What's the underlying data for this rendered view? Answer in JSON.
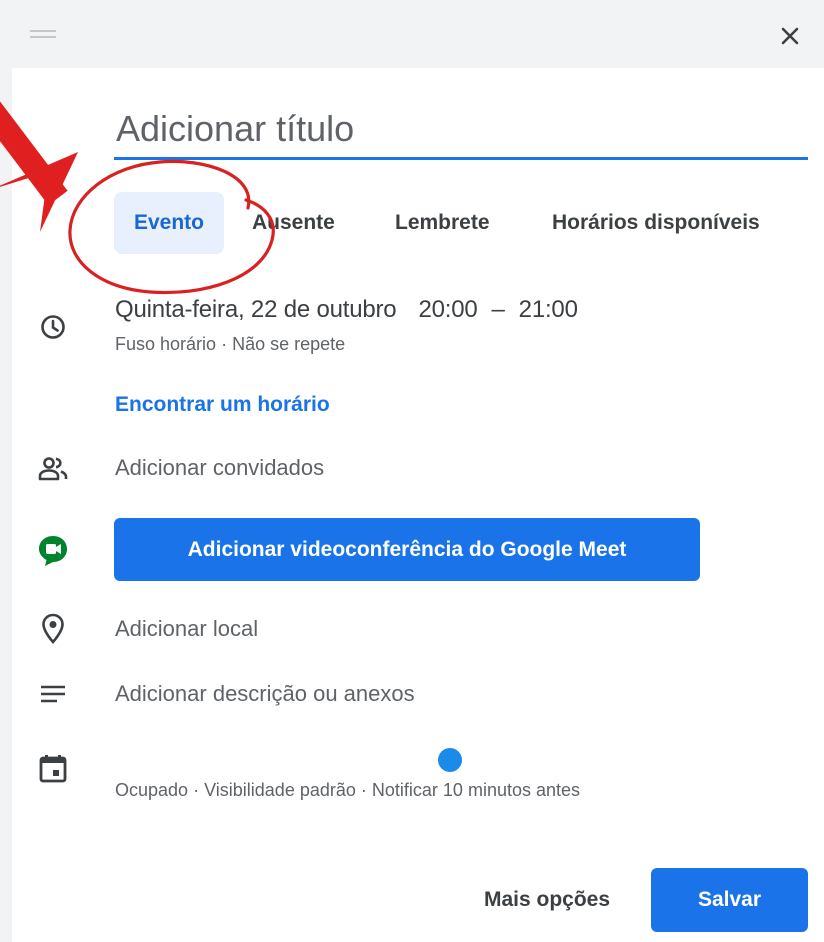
{
  "dialog": {
    "close_icon": "close-icon",
    "drag_icon": "drag-handle-icon"
  },
  "title": {
    "placeholder": "Adicionar título"
  },
  "tabs": [
    {
      "label": "Evento",
      "selected": true
    },
    {
      "label": "Ausente",
      "selected": false
    },
    {
      "label": "Lembrete",
      "selected": false
    },
    {
      "label": "Horários disponíveis",
      "selected": false
    }
  ],
  "datetime": {
    "date": "Quinta-feira, 22 de outubro",
    "start": "20:00",
    "separator": "–",
    "end": "21:00",
    "timezone": "Fuso horário",
    "dot": "·",
    "recurrence": "Não se repete",
    "icon": "clock-icon"
  },
  "find_time": {
    "label": "Encontrar um horário"
  },
  "guests": {
    "placeholder": "Adicionar convidados",
    "icon": "people-icon"
  },
  "meet": {
    "label": "Adicionar videoconferência do Google Meet",
    "icon": "google-meet-icon"
  },
  "location": {
    "placeholder": "Adicionar local",
    "icon": "location-pin-icon"
  },
  "description": {
    "placeholder": "Adicionar descrição ou anexos",
    "icon": "notes-icon"
  },
  "status": {
    "busy": "Ocupado",
    "visibility": "Visibilidade padrão",
    "notify": "Notificar 10 minutos antes",
    "dot": "·",
    "icon": "calendar-icon"
  },
  "footer": {
    "more_options": "Mais opções",
    "save": "Salvar"
  },
  "colors": {
    "accent": "#1a73e8",
    "tab_selected_bg": "#e8f0fe",
    "annotation_red": "#e02020"
  }
}
